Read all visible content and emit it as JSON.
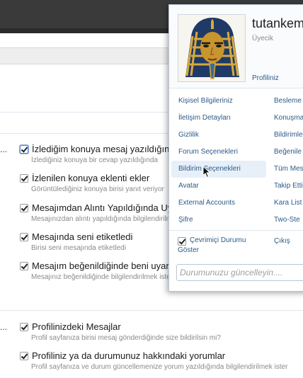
{
  "preferences": {
    "group1": [
      {
        "label": "İzlediğim konuya mesaj yazıldığında",
        "desc": "İzlediğiniz konuya bir cevap yazıldığında",
        "checked": true
      },
      {
        "label": "İzlenilen konuya eklenti ekler",
        "desc": "Görüntülediğiniz konuya birisi yanıt veriyor",
        "checked": true
      },
      {
        "label": "Mesajımdan Alıntı Yapıldığında Uyar",
        "desc": "Mesajınızdan alıntı yapıldığında bilgilendirilmek",
        "checked": true
      },
      {
        "label": "Mesajında seni etiketledi",
        "desc": "Birisi seni mesajında etiketledi",
        "checked": true
      },
      {
        "label": "Mesajım beğenildiğinde beni uyar",
        "desc": "Mesajınız beğenildiğinde bilgilendirilmek ister",
        "checked": true
      }
    ],
    "group2": [
      {
        "label": "Profilinizdeki Mesajlar",
        "desc": "Profil sayfanıza birisi mesaj gönderdiğinde size bildirilsin mi?",
        "checked": true
      },
      {
        "label": "Profiliniz ya da durumunuz hakkındaki yorumlar",
        "desc": "Profil sayfanıza ve durum güncellemenize yorum yazıldığında bilgilendirilmek ister",
        "checked": true
      }
    ],
    "ellipsis": "..."
  },
  "user_menu": {
    "username": "tutankem",
    "role": "Üyecik",
    "profile_link": "Profiliniz",
    "col1": [
      "Kişisel Bilgileriniz",
      "İletişim Detayları",
      "Gizlilik",
      "Forum Seçenekleri",
      "Bildirim Seçenekleri",
      "Avatar",
      "External Accounts",
      "Şifre"
    ],
    "col2": [
      "Besleme",
      "Konuşma",
      "Bildirimle",
      "Beğenile",
      "Tüm Mes",
      "Takip Etti",
      "Kara List",
      "Two-Ste"
    ],
    "hovered_item": "Bildirim Seçenekleri",
    "online_status_label": "Çevrimiçi Durumu Göster",
    "online_status_checked": true,
    "logout": "Çıkış",
    "status_placeholder": "Durumunuzu güncelleyin...."
  },
  "colors": {
    "link": "#2d5a8a",
    "topbar": "#3a3a3a",
    "hover": "#e7f0f9"
  }
}
